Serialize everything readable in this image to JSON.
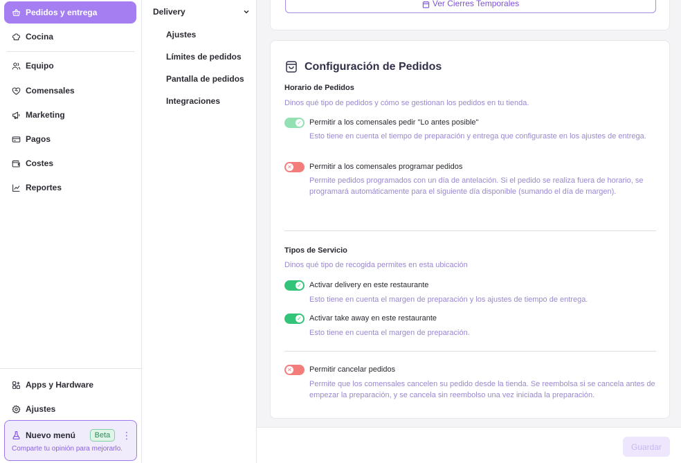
{
  "sidebar": {
    "items": [
      {
        "label": "Pedidos y entrega",
        "icon": "basket-icon",
        "active": true
      },
      {
        "label": "Cocina",
        "icon": "chef-hat-icon"
      },
      {
        "label": "Equipo",
        "icon": "users-icon"
      },
      {
        "label": "Comensales",
        "icon": "heart-handshake-icon"
      },
      {
        "label": "Marketing",
        "icon": "megaphone-icon"
      },
      {
        "label": "Pagos",
        "icon": "credit-card-icon"
      },
      {
        "label": "Costes",
        "icon": "wallet-icon"
      },
      {
        "label": "Reportes",
        "icon": "chart-icon"
      }
    ],
    "bottom_items": [
      {
        "label": "Apps y Hardware",
        "icon": "apps-grid-icon"
      },
      {
        "label": "Ajustes",
        "icon": "gear-icon"
      }
    ],
    "promo": {
      "title": "Nuevo menú",
      "badge": "Beta",
      "subtitle": "Comparte tu opinión para mejorarlo."
    }
  },
  "subnav": {
    "section": "Delivery",
    "items": [
      "Ajustes",
      "Límites de pedidos",
      "Pantalla de pedidos",
      "Integraciones"
    ]
  },
  "top_card": {
    "button_label": "Ver Cierres Temporales"
  },
  "config": {
    "title": "Configuración de Pedidos",
    "schedule": {
      "title": "Horario de Pedidos",
      "subtitle": "Dinos qué tipo de pedidos y cómo se gestionan los pedidos en tu tienda.",
      "options": [
        {
          "label": "Permitir a los comensales pedir \"Lo antes posible\"",
          "description": "Esto tiene en cuenta el tiempo de preparación y entrega que configuraste en los ajustes de entrega.",
          "enabled": true
        },
        {
          "label": "Permitir a los comensales programar pedidos",
          "description": "Permite pedidos programados con un día de antelación. Si el pedido se realiza fuera de horario, se programará automáticamente para el siguiente día disponible (sumando el día de margen).",
          "enabled": false
        }
      ]
    },
    "service": {
      "title": "Tipos de Servicio",
      "subtitle": "Dinos qué tipo de recogida permites en esta ubicación",
      "options": [
        {
          "label": "Activar delivery en este restaurante",
          "description": "Esto tiene en cuenta el margen de preparación y los ajustes de tiempo de entrega.",
          "enabled": true
        },
        {
          "label": "Activar take away en este restaurante",
          "description": "Esto tiene en cuenta el margen de preparación.",
          "enabled": true
        }
      ]
    },
    "cancel": {
      "label": "Permitir cancelar pedidos",
      "description": "Permite que los comensales cancelen su pedido desde la tienda. Se reembolsa si se cancela antes de empezar la preparación, y se cancela sin reembolso una vez iniciada la preparación.",
      "enabled": false
    }
  },
  "footer": {
    "save_label": "Guardar"
  },
  "colors": {
    "accent": "#a57ff2",
    "toggle_on": "#33c47a",
    "toggle_off": "#f37d7a",
    "muted_text": "#9a88cf"
  }
}
